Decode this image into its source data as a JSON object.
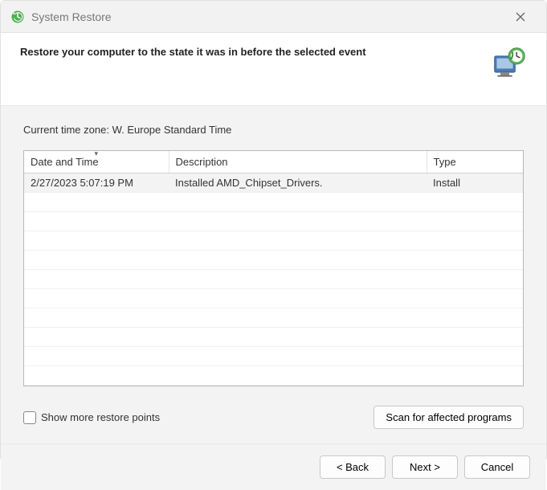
{
  "window": {
    "title": "System Restore"
  },
  "header": {
    "headline": "Restore your computer to the state it was in before the selected event"
  },
  "body": {
    "timezone_label": "Current time zone:",
    "timezone_value": "W. Europe Standard Time",
    "columns": {
      "date": "Date and Time",
      "desc": "Description",
      "type": "Type"
    },
    "rows": [
      {
        "date": "2/27/2023 5:07:19 PM",
        "desc": "Installed AMD_Chipset_Drivers.",
        "type": "Install"
      }
    ],
    "show_more_label": "Show more restore points",
    "scan_button": "Scan for affected programs"
  },
  "footer": {
    "back": "< Back",
    "next": "Next >",
    "cancel": "Cancel"
  }
}
